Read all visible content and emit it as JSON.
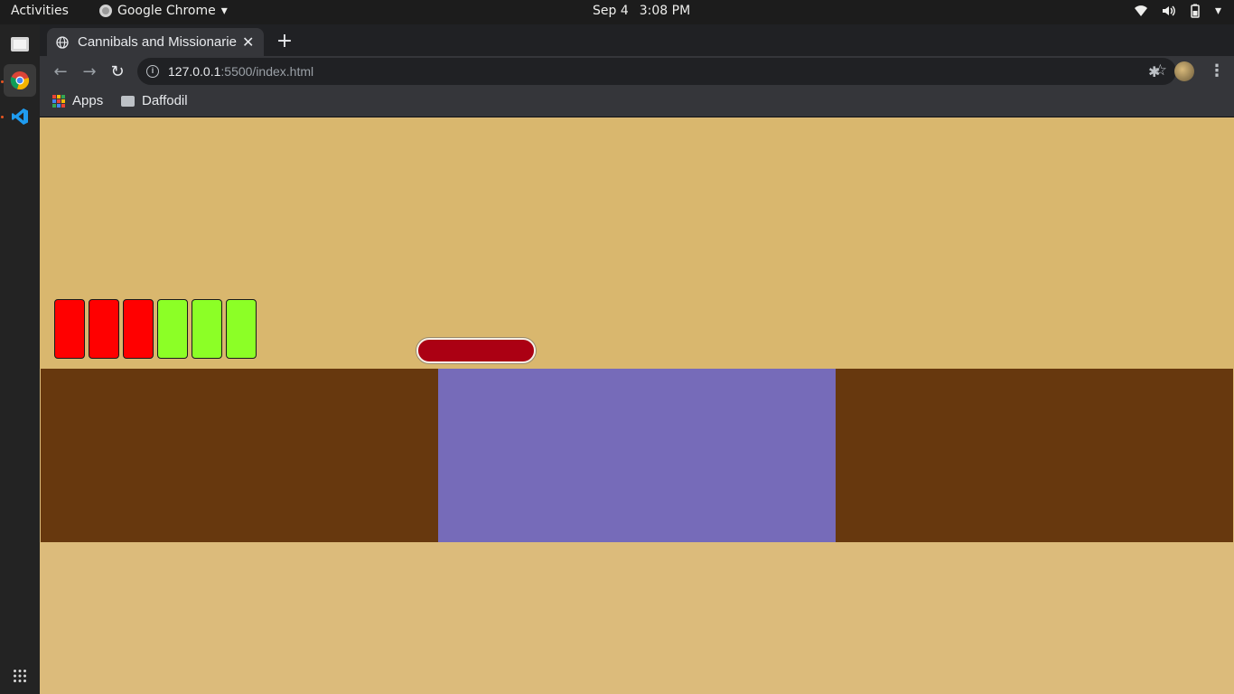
{
  "topbar": {
    "activities": "Activities",
    "app_name": "Google Chrome",
    "date": "Sep 4",
    "time": "3:08 PM"
  },
  "dock": {
    "items": [
      "files-icon",
      "chrome-icon",
      "vscode-icon",
      "app-grid-icon"
    ]
  },
  "browser": {
    "tab_title": "Cannibals and Missionaries",
    "url_host": "127.0.0.1",
    "url_rest": ":5500/index.html",
    "bookmarks": [
      {
        "label": "Apps",
        "icon": "apps-grid-icon"
      },
      {
        "label": "Daffodil",
        "icon": "folder-icon"
      }
    ]
  },
  "game": {
    "left_bank_people": [
      {
        "type": "cannibal",
        "color": "#ff0000"
      },
      {
        "type": "cannibal",
        "color": "#ff0000"
      },
      {
        "type": "cannibal",
        "color": "#ff0000"
      },
      {
        "type": "missionary",
        "color": "#8cff26"
      },
      {
        "type": "missionary",
        "color": "#8cff26"
      },
      {
        "type": "missionary",
        "color": "#8cff26"
      }
    ],
    "boat_color": "#ab0013",
    "river_color": "#766bb9",
    "bank_color": "#67380e",
    "sky_color": "#d9b76e"
  }
}
